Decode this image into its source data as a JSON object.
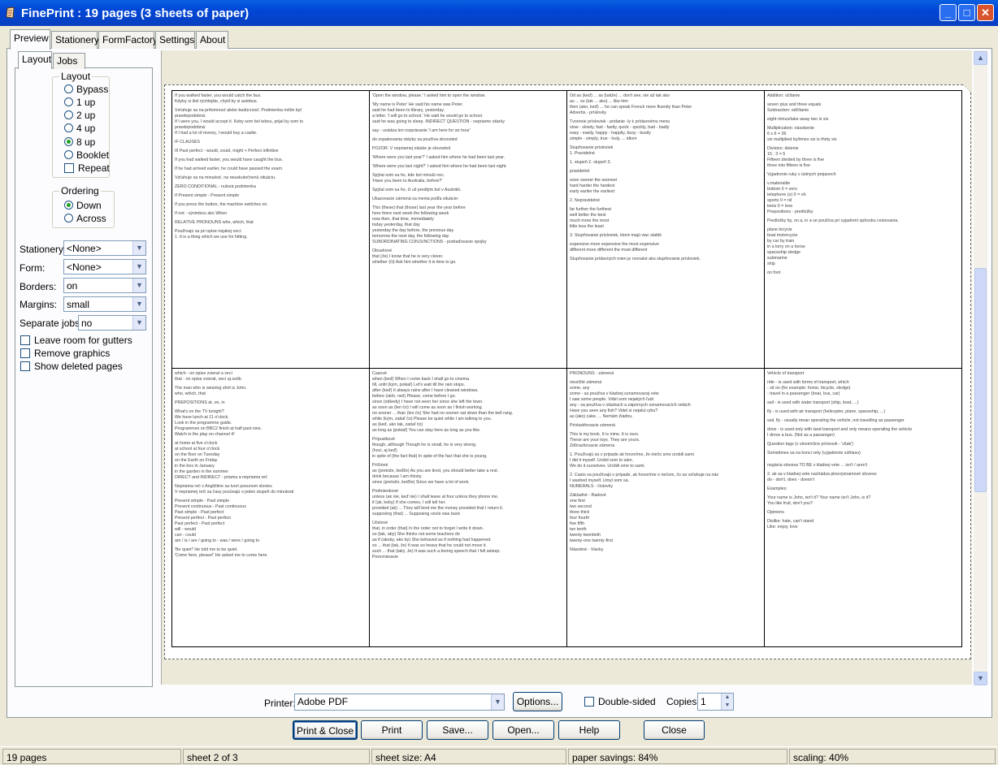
{
  "window": {
    "title": "FinePrint : 19 pages (3 sheets of paper)",
    "min": "_",
    "max": "□",
    "close": "✕"
  },
  "tabs": [
    "Preview",
    "Stationery",
    "FormFactory",
    "Settings",
    "About"
  ],
  "subtabs": [
    "Layout",
    "Jobs"
  ],
  "layout_group": {
    "title": "Layout",
    "options": [
      "Bypass",
      "1 up",
      "2 up",
      "4 up",
      "8 up",
      "Booklet"
    ],
    "selected": "8 up",
    "repeat_label": "Repeat"
  },
  "ordering_group": {
    "title": "Ordering",
    "options": [
      "Down",
      "Across"
    ],
    "selected": "Down"
  },
  "fields": {
    "stationery": {
      "label": "Stationery:",
      "value": "<None>"
    },
    "form": {
      "label": "Form:",
      "value": "<None>"
    },
    "borders": {
      "label": "Borders:",
      "value": "on"
    },
    "margins": {
      "label": "Margins:",
      "value": "small"
    },
    "separate_jobs": {
      "label": "Separate jobs:",
      "value": "no"
    }
  },
  "checkboxes": [
    "Leave room for gutters",
    "Remove graphics",
    "Show deleted pages"
  ],
  "printer": {
    "label": "Printer:",
    "value": "Adobe PDF",
    "options_button": "Options...",
    "double_sided": "Double-sided",
    "copies_label": "Copies:",
    "copies": "1"
  },
  "buttons": [
    "Print & Close",
    "Print",
    "Save...",
    "Open...",
    "Help",
    "Close"
  ],
  "status": [
    "19 pages",
    "sheet 2 of 3",
    "sheet size: A4",
    "paper savings: 84%",
    "scaling: 40%"
  ],
  "pages": [
    [
      "If you walked faster, you would catch the bus.",
      "Kdyby si šiel rýchlejšie, chytil by si autobus.",
      "",
      "Vzťahuje sa na prítomnosť alebo budúcnosť. Podmienka môže byť",
      "pravdepodobná:",
      "If I were you, I would accept it. Keby som bol tebou, prijal by som to",
      "pravdepodobná:",
      "If I had a lot of money, I would buy a castle.",
      "",
      "IF CLAUSES",
      "",
      "III Past perfect - would, could, might + Perfect infinitive",
      "",
      "If you had walked faster, you would have caught the bus.",
      "",
      "If he had arrived earlier, he could have passed the exam.",
      "",
      "Vzťahuje sa na minulosť, na neuskutočnenú situáciu.",
      "",
      "ZERO CONDITIONAL - nulová podmienka",
      "",
      "If Present simple - Present simple",
      "",
      "If you press the button, the machine switches on.",
      "",
      "If not - výnimkou ako When",
      "",
      "RELATIVE PRONOUNS who, which, that",
      "",
      "Používajú sa pri opise nejakej veci:",
      "1. It is a thing which we use for hitting."
    ],
    [
      "'Open the window, please.' I asked him to open the window.",
      "",
      "'My name is Peter'  He said his name was Peter.",
      "said he had been to library, yesterday.",
      "a letter. 'I will go to school.' He said he would go to school.",
      "said he was going to sleep. INDIRECT QUESTION - nepriame otázky",
      "",
      "say - uvádza len rozprávanie 'I am here for an hour'",
      "",
      "do zopakovania otázky sa používa slovosled",
      "",
      "POZOR: V nepriamej otázke je slovosled",
      "",
      "'Where were you last year?' I asked him where he had been last year.",
      "",
      "'Where were you last night?' I asked him where he had been last night.",
      "",
      "Spýtal som sa ho, kde bol minulú noc.",
      "'Have you been to Australia, before?'",
      "",
      "Spýtal som sa ho, či už predtým bol v Austrálii.",
      "",
      "Ukazovacie zámená sa menia podľa situácie:",
      "",
      "This (these) that (those) last year the year before",
      "here there next week the following week",
      "now then, that time, immediately",
      "today yesterday, that day",
      "yesterday the day before, the previous day",
      "tomorrow the next day, the following day",
      "SUBORDINATING CONJUNCTIONS - podraďovacie spojky",
      "",
      "Obsahové",
      "that (že) I know that he is very clever.",
      "whether (či) Ask him whether it is time to go."
    ],
    [
      "Od as (keď) ... as (takže) ... don't see, nie až tak ako",
      "as ... so (tak ... ako) ... like him",
      "then (ako, keď) ... he can speak French more fluently than Peter",
      "Adverbs - príslovky",
      "",
      "Tvorenie prísloviek - pridanie -ly k prídavnému menu",
      "slow - slowly, fast - fastly, quick - quickly, bad - badly",
      "easy - easily, happy - happily, busy - busily",
      "simple - simply, true - truly, ... idiom",
      "",
      "Stupňovanie prísloviek",
      "1. Pravidelné",
      "",
      "1. stupeň 2. stupeň 3.",
      "",
      "pravidelné",
      "",
      "soon sooner the soonest",
      "hard harder the hardest",
      "early earlier the earliest",
      "",
      "2. Nepravidelné",
      "",
      "far further the furthest",
      "well better the best",
      "much more the most",
      "little less the least",
      "",
      "3. Stupňovanie prísloviek, ktoré majú viac slabík",
      "",
      "expensive more expensive the most expensive",
      "different more different the most different",
      "",
      "Stupňovanie prídavných mien je rovnaké ako stupňovanie prísloviek."
    ],
    [
      "Addition: sčítanie",
      "",
      "seven plus and three equals",
      "Subtraction: odčítanie",
      "",
      "eight minus/take away two is six",
      "",
      "Multiplication: násobenie",
      "6 x 6 = 36",
      "six multiplied by/times six is thirty six",
      "",
      "Division: delenie",
      "15 : 3 = 5",
      "Fifteen divided by three is five",
      "three into fifteen is five",
      "",
      "Vyjadrenie ruky v ústnych prejavoch",
      "",
      "v.materialite",
      "bottom 0 = zero",
      "telephone (o) 0 = oh",
      "sports 0 = nil",
      "tenis 0 = love",
      "Prepositions - predložky",
      "",
      "Predložky by, on a, in a se používa pri vyjadrení spôsobu cestovania.",
      "",
      "plane bicycle",
      "boat motorcycle",
      "by car by train",
      "in a lorry on a horse",
      "spaceship sledge",
      "submarine",
      "ship",
      "",
      "on foot"
    ],
    [
      "which - on opise zvierat a vecí",
      "that - on opise zvierat, vecí aj osôb",
      "",
      "The man who is wearing shirt is John.",
      "who, which, that",
      "",
      "PREPOSITIONS at, on, in",
      "",
      "What's on the TV tonight?",
      "We have lunch at 11 o'clock.",
      "Look in the programme guide.",
      "Programmes on BBC2 finish at half past nine.",
      "Watch in the play on channel 4!",
      "",
      "at home at five o'clock",
      "at school at four o'clock",
      "on the floor on Tuesday",
      "on the Earth on Friday",
      "in the box in January",
      "in the garden in the summer",
      "DIRECT and INDIRECT - priama a nepriama reč",
      "",
      "Nepriama reč v Angličtine sa tvorí posunom slovies",
      "V nepriamej reči sa časy posúvajú o jeden stupeň do minulosti",
      "",
      "Present simple - Past simple",
      "Present continuous - Past continuous",
      "Past simple - Past perfect",
      "Present perfect - Past perfect",
      "Past perfect - Past perfect",
      "will - would",
      "can - could",
      "am / is / are / going to - was / were / going to",
      "",
      "'Be quiet!' He told me to be quiet.",
      "'Come here, please!' He asked me to come here."
    ],
    [
      "Časové",
      "when (keď) When I come back I shall go to cinema.",
      "till, until (kým, pokiaľ) Let's wait till the rain stops.",
      "after (keď) It always rains after I have cleaned windows.",
      "before (skôr, než) Please, come before I go.",
      "since (odkedy) I have not seen her since she left the town.",
      "as soon as (len čo) I will come as soon as I finish working.",
      "no sooner ... than (len čo) She had no sooner sat down than the bell rang.",
      "while (kým, zatiaľ čo) Please be quiet while I am talking to you.",
      "as (keď, ako tak, zatiaľ čo)",
      "as long as (pokiaľ) You can stay here as long as you like.",
      "",
      "Prípustkové",
      "though, although Though he is small, he is very strong.",
      "(hoci, aj keď)",
      "in spite of (the fact that) In spite of the fact that she is young.",
      "",
      "Príčinné",
      "as (pretože, keďže) As you are tired, you should better take a rest.",
      "drink because I am thirsty.",
      "since (pretože, keďže) Since we have a lot of work.",
      "",
      "Podmienkové",
      "unless (ak nie, keď nie) I shall leave at four unless they phone me.",
      "if (ak, keby) If she comes, I will tell her.",
      "provided (ak) ... They will lend me the money provided that I return it.",
      "supposing (that) ... Supposing uncle was back",
      "",
      "Účelové",
      "that, in order (that) In the order not to forget I write it down.",
      "so (tak, aby) She thinks not some teachers do",
      "as if (akoby, ako by) She behaved as if nothing had happened.",
      "so ... that (tak, že) It was so heavy that he could not move it.",
      "such ... that (taký, že) It was such a boring speech that I fell asleep.",
      "Porovnávacie"
    ],
    [
      "PRONOUNS - zámená",
      "",
      "neurčité zámená",
      "some, any",
      "some - sa používa v kladnej oznamovacej vete",
      "I saw some people. Videl som nejakých ľudí.",
      "any - sa používa v otázkach a zápornych oznamovacích vetách",
      "Have you seen any fish? Videl si nejakú rybu?",
      "as (ako) cake, ... Nemám žiadnu.",
      "",
      "Privlastňovacie zámená",
      "",
      "This is my book. It is mine. It is ours.",
      "These are your toys. They are yours.",
      "Zdôrazňovacie zámená",
      "",
      "1. Používajú sa v prípade ak hovoríme, že niečo sme urobili sami",
      "I did it myself. Urobil som to sám.",
      "We do it ourselves. Urobili sme to sami.",
      "",
      "2. Často sa používajú v prípade, ak hovoríme o nečom, čo sa vzťahuje na nás",
      "I washed myself. Umyl som sa.",
      "NUMERALS - číslovky",
      "",
      "Základné - Radové",
      "one first",
      "two second",
      "three third",
      "four fourth",
      "five fifth",
      "ten tenth",
      "twenty twentieth",
      "twenty-one twenty-first",
      "",
      "Násobné - Viacky"
    ],
    [
      "Vehicle of transport",
      "",
      "ride - is used with forms of transport, which",
      "- sit on (for example: horse, bicycle, sledge)",
      "- travel in a passenger (boat, bus, car)",
      "",
      "sail - is used with water transport (ship, boat, ...)",
      "",
      "fly - is used with air transport (helicopter, plane, spaceship, ...)",
      "",
      "sail, fly - usually mean operating the vehicle, not travelling as passenger",
      "",
      "drive - is used only with land transport and only means operating the vehicle",
      "I drove a bus. (Not as a passenger)",
      "",
      "Question tags (v slovenčine prívesok - 'však')",
      "",
      "Sometimes sa na konci vety (vyjadrenie súhlasu)",
      "",
      "",
      "negácia slovesa TO BE v kladnej vete ... isn't / aren't",
      "",
      "2. ak sa v kladnej vete nachádza plnovýznamové sloveso",
      "do - don't, does - doesn't",
      "",
      "Examples:",
      "",
      "Your name is John, isn't it? Your name isn't John, is it?",
      "You like fruit, don't you?",
      "",
      "Opinions",
      "",
      "Dislike: hate, can't stand",
      "Like: enjoy, love"
    ]
  ]
}
